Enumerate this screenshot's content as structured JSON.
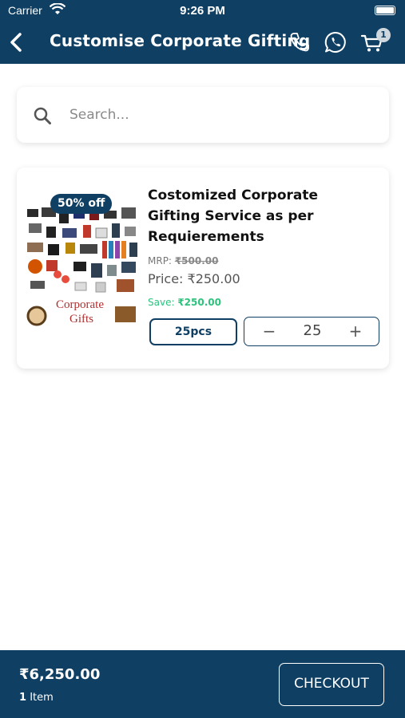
{
  "status_bar": {
    "carrier": "Carrier",
    "time": "9:26 PM"
  },
  "header": {
    "title": "Customise Corporate Gifting",
    "cart_count": "1"
  },
  "search": {
    "placeholder": "Search..."
  },
  "product": {
    "discount": "50% off",
    "image_caption_line1": "Corporate",
    "image_caption_line2": "Gifts",
    "name": "Costomized Corporate Gifting Service as per Requierements",
    "mrp_label": "MRP:",
    "mrp_value": "₹500.00",
    "price_label": "Price:",
    "price_value": "₹250.00",
    "save_label": "Save:",
    "save_value": "₹250.00",
    "unit": "25pcs",
    "minus": "−",
    "quantity": "25",
    "plus": "+"
  },
  "footer": {
    "total": "₹6,250.00",
    "item_count": "1",
    "item_label": "Item",
    "checkout_label": "CHECKOUT"
  },
  "colors": {
    "primary": "#0f3f63",
    "save_green": "#2ec27e"
  }
}
